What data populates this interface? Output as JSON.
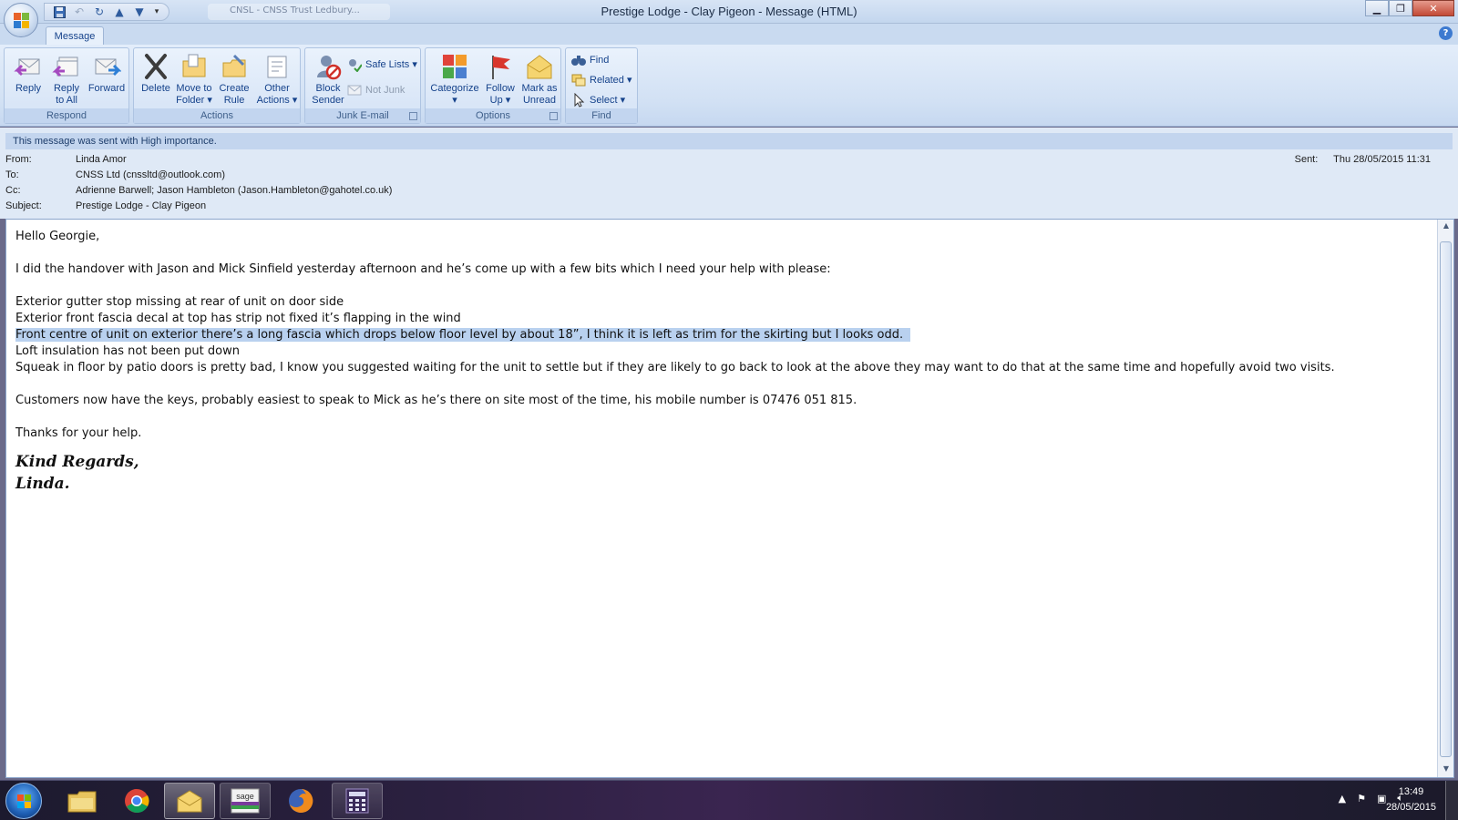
{
  "window": {
    "title": "Prestige Lodge - Clay Pigeon - Message (HTML)",
    "background_tab": "CNSL - CNSS Trust Ledbury..."
  },
  "ribbon": {
    "tab": "Message",
    "groups": {
      "respond": {
        "label": "Respond",
        "reply": "Reply",
        "reply_all": "Reply\nto All",
        "forward": "Forward"
      },
      "actions": {
        "label": "Actions",
        "delete": "Delete",
        "move_to_folder": "Move to\nFolder ▾",
        "create_rule": "Create\nRule",
        "other_actions": "Other\nActions ▾"
      },
      "junk": {
        "label": "Junk E-mail",
        "block_sender": "Block\nSender",
        "safe_lists": "Safe Lists ▾",
        "not_junk": "Not Junk"
      },
      "options": {
        "label": "Options",
        "categorize": "Categorize\n▾",
        "follow_up": "Follow\nUp ▾",
        "mark_unread": "Mark as\nUnread"
      },
      "find": {
        "label": "Find",
        "find": "Find",
        "related": "Related ▾",
        "select": "Select ▾"
      }
    }
  },
  "header": {
    "importance": "This message was sent with High importance.",
    "from_label": "From:",
    "from": "Linda Amor",
    "to_label": "To:",
    "to": "CNSS Ltd (cnssltd@outlook.com)",
    "cc_label": "Cc:",
    "cc": "Adrienne Barwell; Jason Hambleton (Jason.Hambleton@gahotel.co.uk)",
    "subject_label": "Subject:",
    "subject": "Prestige Lodge - Clay Pigeon",
    "sent_label": "Sent:",
    "sent": "Thu 28/05/2015 11:31"
  },
  "body": {
    "greeting": "Hello Georgie,",
    "intro": "I did the handover with Jason and Mick Sinfield yesterday afternoon and he’s come up with a few bits which I need your help with please:",
    "items": [
      "Exterior gutter stop missing at rear of unit on door side",
      "Exterior front fascia decal at top has strip not fixed it’s flapping in the wind",
      "Front centre of unit on exterior there’s a long fascia which drops below floor level by about 18”, I think it is left as trim for the skirting but I looks odd.",
      "Loft insulation has not been put down",
      "Squeak in floor by patio doors is pretty bad, I know you suggested waiting for the unit to settle but if they are likely to go back to look at the above they may want to do that at the same time and hopefully avoid two visits."
    ],
    "customers": "Customers now have the keys, probably easiest to speak to Mick as he’s there on site most of the time, his mobile number is 07476 051 815.",
    "thanks": "Thanks for your help.",
    "sign_line1": "Kind Regards,",
    "sign_line2": "Linda."
  },
  "taskbar": {
    "time": "13:49",
    "date": "28/05/2015",
    "apps": [
      "windows-explorer",
      "chrome",
      "outlook",
      "sage",
      "firefox",
      "calculator-app"
    ]
  }
}
